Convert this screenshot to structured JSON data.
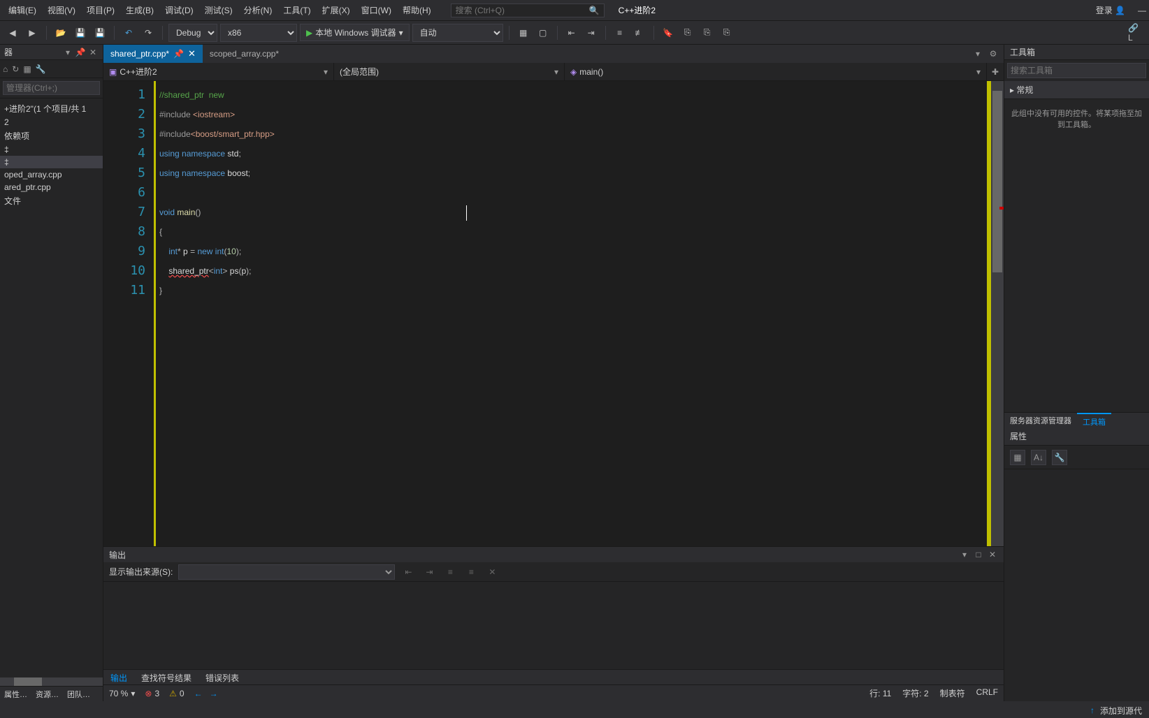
{
  "menu": {
    "items": [
      "编辑(E)",
      "视图(V)",
      "项目(P)",
      "生成(B)",
      "调试(D)",
      "测试(S)",
      "分析(N)",
      "工具(T)",
      "扩展(X)",
      "窗口(W)",
      "帮助(H)"
    ],
    "search_placeholder": "搜索 (Ctrl+Q)",
    "project": "C++进阶2",
    "login": "登录"
  },
  "toolbar": {
    "config": "Debug",
    "platform": "x86",
    "run": "本地 Windows 调试器",
    "auto": "自动"
  },
  "sidebar": {
    "title": "器",
    "search_placeholder": "管理器(Ctrl+;)",
    "tree": [
      "+进阶2\"(1 个项目/共 1",
      "2",
      "依赖项",
      "‡",
      "‡",
      "oped_array.cpp",
      "ared_ptr.cpp",
      "文件"
    ],
    "bottom_tabs": [
      "属性…",
      "资源…",
      "团队…"
    ]
  },
  "tabs": {
    "items": [
      {
        "name": "shared_ptr.cpp*",
        "active": true
      },
      {
        "name": "scoped_array.cpp*",
        "active": false
      }
    ]
  },
  "navbar": {
    "project": "C++进阶2",
    "scope": "(全局范围)",
    "func": "main()"
  },
  "code": {
    "lines": [
      {
        "n": 1,
        "html": "<span class='cm'>//shared_ptr  new</span>"
      },
      {
        "n": 2,
        "html": "<span class='pp'>#include</span> <span class='inc'>&lt;iostream&gt;</span>"
      },
      {
        "n": 3,
        "html": "<span class='pp'>#include</span><span class='inc'>&lt;boost/smart_ptr.hpp&gt;</span>"
      },
      {
        "n": 4,
        "html": "<span class='kw'>using</span> <span class='kw'>namespace</span> <span class='txt'>std</span><span class='op'>;</span>"
      },
      {
        "n": 5,
        "html": "<span class='kw'>using</span> <span class='kw'>namespace</span> <span class='txt'>boost</span><span class='op'>;</span>"
      },
      {
        "n": 6,
        "html": ""
      },
      {
        "n": 7,
        "html": "<span class='kw'>void</span> <span class='fn'>main</span><span class='op'>()</span><span class='cursor'></span>"
      },
      {
        "n": 8,
        "html": "<span class='op'>{</span>"
      },
      {
        "n": 9,
        "html": "    <span class='kw'>int</span><span class='op'>*</span> <span class='txt'>p</span> <span class='op'>=</span> <span class='kw'>new</span> <span class='kw'>int</span><span class='op'>(</span><span class='num'>10</span><span class='op'>);</span>"
      },
      {
        "n": 10,
        "html": "    <span class='txt err'>shared_ptr</span><span class='op'>&lt;</span><span class='kw'>int</span><span class='op'>&gt;</span> <span class='txt'>ps</span><span class='op'>(</span><span class='txt'>p</span><span class='op'>);</span>"
      },
      {
        "n": 11,
        "html": "<span class='op'>}</span>"
      }
    ]
  },
  "output": {
    "title": "输出",
    "source_label": "显示输出来源(S):",
    "tabs": [
      "输出",
      "查找符号结果",
      "错误列表"
    ]
  },
  "status": {
    "zoom": "70 %",
    "errors": "3",
    "warnings": "0",
    "line": "行: 11",
    "col": "字符: 2",
    "ins": "制表符",
    "eol": "CRLF"
  },
  "rightpane": {
    "toolbox_title": "工具箱",
    "toolbox_search": "搜索工具箱",
    "section": "▸ 常规",
    "empty": "此组中没有可用的控件。将某项拖至加到工具箱。",
    "tabs": [
      "服务器资源管理器",
      "工具箱"
    ],
    "props_title": "属性"
  },
  "bottom": {
    "add_source": "添加到源代"
  }
}
